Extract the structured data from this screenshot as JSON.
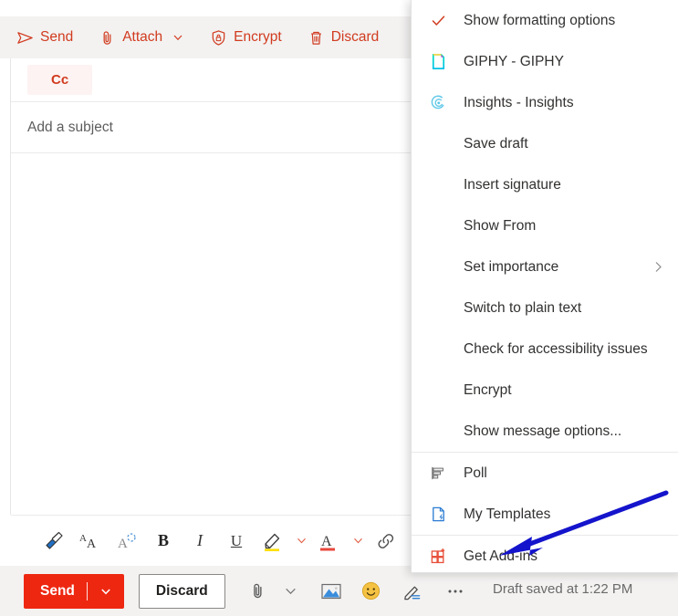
{
  "topbar": {
    "items": [
      {
        "label": "Send",
        "icon": "send-icon"
      },
      {
        "label": "Attach",
        "icon": "paperclip-icon",
        "caret": true
      },
      {
        "label": "Encrypt",
        "icon": "shield-lock-icon"
      },
      {
        "label": "Discard",
        "icon": "trash-icon"
      }
    ],
    "accent_color": "#d13b1f",
    "background": "#f3f2f1"
  },
  "compose": {
    "cc_chip": "Cc",
    "subject_placeholder": "Add a subject",
    "body_value": ""
  },
  "format_toolbar": {
    "buttons": [
      {
        "name": "format-painter-icon",
        "label": "Format painter"
      },
      {
        "name": "grow-font-icon",
        "label": "Increase font size"
      },
      {
        "name": "clear-formatting-icon",
        "label": "Clear formatting"
      },
      {
        "name": "bold-icon",
        "label": "B"
      },
      {
        "name": "italic-icon",
        "label": "I"
      },
      {
        "name": "underline-icon",
        "label": "U"
      },
      {
        "name": "highlight-icon",
        "label": "Highlight"
      },
      {
        "name": "highlight-chevron-icon",
        "label": "Highlight options"
      },
      {
        "name": "font-color-icon",
        "label": "A"
      },
      {
        "name": "font-color-chevron-icon",
        "label": "Font color options"
      },
      {
        "name": "link-icon",
        "label": "Insert link"
      }
    ]
  },
  "action_bar": {
    "send_label": "Send",
    "discard_label": "Discard",
    "send_color": "#ee2711",
    "icons": [
      {
        "name": "attach-icon",
        "label": "Attach"
      },
      {
        "name": "attach-chevron-icon",
        "label": "Attach options"
      },
      {
        "name": "insert-picture-icon",
        "label": "Insert picture"
      },
      {
        "name": "emoji-icon",
        "label": "Emoji"
      },
      {
        "name": "signature-ink-icon",
        "label": "Signature"
      },
      {
        "name": "more-options-icon",
        "label": "More options"
      }
    ],
    "draft_status": "Draft saved at 1:22 PM"
  },
  "menu": {
    "items": [
      {
        "label": "Show formatting options",
        "icon": "checkmark-icon",
        "checked": true
      },
      {
        "label": "GIPHY - GIPHY",
        "icon": "giphy-icon"
      },
      {
        "label": "Insights - Insights",
        "icon": "insights-icon"
      },
      {
        "label": "Save draft",
        "icon": null
      },
      {
        "label": "Insert signature",
        "icon": null
      },
      {
        "label": "Show From",
        "icon": null
      },
      {
        "label": "Set importance",
        "icon": null,
        "submenu": true
      },
      {
        "label": "Switch to plain text",
        "icon": null
      },
      {
        "label": "Check for accessibility issues",
        "icon": null
      },
      {
        "label": "Encrypt",
        "icon": null
      },
      {
        "label": "Show message options...",
        "icon": null
      },
      {
        "label": "Poll",
        "icon": "poll-icon",
        "separator_before": true
      },
      {
        "label": "My Templates",
        "icon": "my-templates-icon"
      },
      {
        "label": "Get Add-ins",
        "icon": "get-addins-icon",
        "separator_before": true
      }
    ]
  },
  "annotation": {
    "arrow_color": "#1414cc",
    "points_to": "Get Add-ins"
  },
  "window": {
    "popout_icon": "pop-out-icon"
  }
}
